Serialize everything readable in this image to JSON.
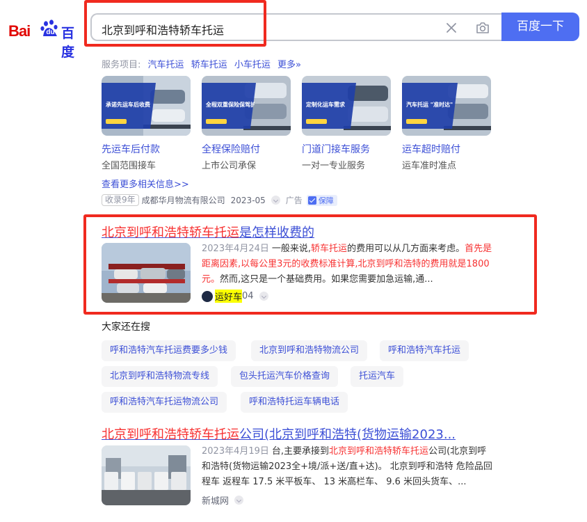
{
  "logo": {
    "part1": "Bai",
    "part2": "du",
    "part3": "百度"
  },
  "search": {
    "query": "北京到呼和浩特轿车托运",
    "button_label": "百度一下"
  },
  "services": {
    "label": "服务项目:",
    "links": [
      "汽车托运",
      "轿车托运",
      "小车托运"
    ],
    "more": "更多»"
  },
  "cards": [
    {
      "title": "先运车后付款",
      "sub": "全国范围接车",
      "banner": "承诺先运车后收费"
    },
    {
      "title": "全程保险赔付",
      "sub": "上市公司承保",
      "banner": "全程双重保险保驾护航"
    },
    {
      "title": "门道门接车服务",
      "sub": "一对一专业服务",
      "banner": "定制化运车需求"
    },
    {
      "title": "运车超时赔付",
      "sub": "运车准时准点",
      "banner": "汽车托运 \"准时达\""
    }
  ],
  "see_more": "查看更多相关信息>>",
  "ad": {
    "tag": "收录9年",
    "company": "成都华月物流有限公司",
    "year": "2023-05",
    "label": "广告",
    "guarantee": "保障"
  },
  "result1": {
    "title_hl": "北京到呼和浩特轿车托运",
    "title_rest": "是怎样收费的",
    "date": "2023年4月24日",
    "s1": "一般来说,",
    "s2": "轿车托运",
    "s3": "的费用可以从几方面来考虑。",
    "s4": "首先是距离因素,以每公里3元的收费标准计算,北京到呼和浩特的费用就是1800元。",
    "s5": "然而,这只是一个基础费用。如果您需要加急运输,通...",
    "source_hl": "运好车",
    "source_rest": "04"
  },
  "related": {
    "label": "大家还在搜",
    "chips": [
      "呼和浩特汽车托运费要多少钱",
      "北京到呼和浩特物流公司",
      "呼和浩特汽车托运",
      "北京到呼和浩特物流专线",
      "包头托运汽车价格查询",
      "托运汽车",
      "呼和浩特汽车托运物流公司",
      "呼和浩特托运车辆电话"
    ]
  },
  "result2": {
    "title_hl": "北京到呼和浩特轿车托运",
    "title_rest": "公司(北京到呼和浩特(货物运输2023...",
    "date": "2023年4月19日",
    "s1": "台,主要承接到",
    "s2": "北京到呼和浩特轿车托运",
    "s3": "公司(北京到呼和浩特(货物运输2023全+境/派+送/直+达)。 北京到呼和浩特 危险品回程车 返程车 17.5 米平板车、 13 米高栏车、 9.6 米回头货车、...",
    "source": "新城网"
  },
  "colors": {
    "accent": "#4e6ef2",
    "link": "#3c4fd6",
    "highlight": "#f73131",
    "annotation": "#f02a1f"
  }
}
